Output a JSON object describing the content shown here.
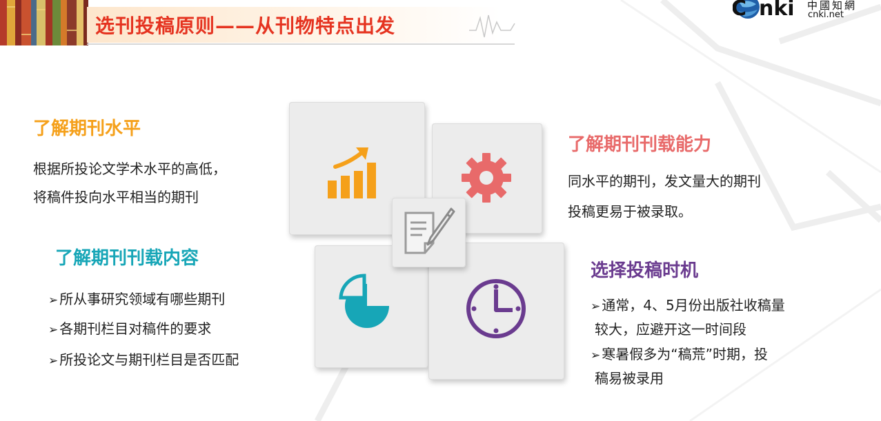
{
  "header": {
    "title": "选刊投稿原则——从刊物特点出发",
    "logo": {
      "brand": "cnki",
      "cn_name": "中國知網",
      "url_text": "cnki.net"
    }
  },
  "colors": {
    "title_red": "#e53320",
    "orange": "#f5a01a",
    "teal": "#17a6b7",
    "coral": "#e86a6a",
    "purple": "#6a3b8f"
  },
  "sections": {
    "level": {
      "heading": "了解期刊水平",
      "lines": [
        "根据所投论文学术水平的高低，",
        "将稿件投向水平相当的期刊"
      ],
      "icon": "bar-chart-growth-icon"
    },
    "capacity": {
      "heading": "了解期刊刊载能力",
      "lines": [
        "同水平的期刊，发文量大的期刊",
        "投稿更易于被录取。"
      ],
      "icon": "gear-icon"
    },
    "content": {
      "heading": "了解期刊刊载内容",
      "bullets": [
        "所从事研究领域有哪些期刊",
        "各期刊栏目对稿件的要求",
        "所投论文与期刊栏目是否匹配"
      ],
      "icon": "pie-chart-icon"
    },
    "timing": {
      "heading": "选择投稿时机",
      "bullets": [
        {
          "line1": "通常，4、5月份出版社收稿量",
          "line2": "较大，应避开这一时间段"
        },
        {
          "line1": "寒暑假多为“稿荒”时期，投",
          "line2": "稿易被录用"
        }
      ],
      "icon": "clock-icon"
    },
    "center_icon": "document-pen-icon"
  },
  "bullet_symbol": "➢"
}
